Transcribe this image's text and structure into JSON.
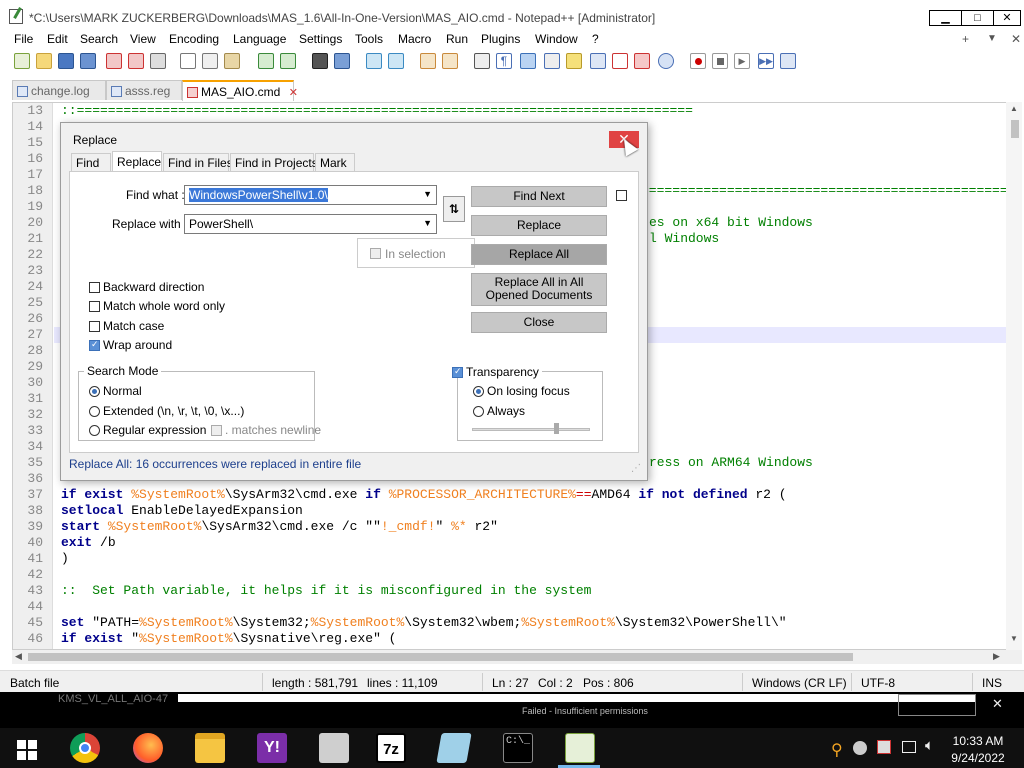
{
  "window": {
    "title": "*C:\\Users\\MARK ZUCKERBERG\\Downloads\\MAS_1.6\\All-In-One-Version\\MAS_AIO.cmd - Notepad++ [Administrator]",
    "min": "▁",
    "max": "□",
    "close": "✕"
  },
  "menu": [
    "File",
    "Edit",
    "Search",
    "View",
    "Encoding",
    "Language",
    "Settings",
    "Tools",
    "Macro",
    "Run",
    "Plugins",
    "Window",
    "?"
  ],
  "menu_right": {
    "plus": "+",
    "down": "▼",
    "close": "✕"
  },
  "tabs": [
    {
      "label": "change.log",
      "active": false
    },
    {
      "label": "asss.reg",
      "active": false
    },
    {
      "label": "MAS_AIO.cmd",
      "active": true
    }
  ],
  "editor": {
    "line_numbers": [
      "13",
      "14",
      "15",
      "16",
      "17",
      "18",
      "19",
      "20",
      "21",
      "22",
      "23",
      "24",
      "25",
      "26",
      "27",
      "28",
      "29",
      "30",
      "31",
      "32",
      "33",
      "34",
      "35",
      "36",
      "37",
      "38",
      "39",
      "40",
      "41",
      "42",
      "43",
      "44",
      "45",
      "46"
    ],
    "visible_fragments": {
      "l13": "::===============================================================================",
      "l18": "====================================================================",
      "l20": "es on x64 bit Windows",
      "l21": "l Windows",
      "l35": "ress on ARM64 Windows"
    },
    "line37": {
      "kw1": "if exist ",
      "var1": "%SystemRoot%",
      "t1": "\\SysArm32\\cmd.exe ",
      "kw2": "if ",
      "var2": "%PROCESSOR_ARCHITECTURE%",
      "op": "==",
      "t2": "AMD64 ",
      "kw3": "if not defined",
      "t3": " r2 ("
    },
    "line38": {
      "kw": "setlocal",
      "t": " EnableDelayedExpansion"
    },
    "line39": {
      "kw": "start ",
      "var1": "%SystemRoot%",
      "t1": "\\SysArm32\\cmd.exe /c \"\"",
      "var2": "!_cmdf!",
      "t2": "\" ",
      "var3": "%*",
      "t3": " r2\""
    },
    "line40": {
      "kw": "exit",
      "t": " /b"
    },
    "line41": ")",
    "line43": "::  Set Path variable, it helps if it is misconfigured in the system",
    "line45": {
      "kw": "set ",
      "t1": "\"PATH=",
      "var1": "%SystemRoot%",
      "t2": "\\System32;",
      "var2": "%SystemRoot%",
      "t3": "\\System32\\wbem;",
      "var3": "%SystemRoot%",
      "t4": "\\System32\\PowerShell\\\""
    },
    "line46": {
      "kw": "if exist ",
      "t1": "\"",
      "var1": "%SystemRoot%",
      "t2": "\\Sysnative\\reg.exe\" ("
    }
  },
  "status": {
    "filetype": "Batch file",
    "length": "length : 581,791",
    "lines": "lines : 11,109",
    "ln": "Ln : 27",
    "col": "Col : 2",
    "pos": "Pos : 806",
    "eol": "Windows (CR LF)",
    "encoding": "UTF-8",
    "ins": "INS"
  },
  "behind": {
    "window_text": "KMS_VL_ALL_AIO-47",
    "failed": "Failed - Insufficient permissions"
  },
  "dialog": {
    "title": "Replace",
    "close": "✕",
    "tabs": [
      "Find",
      "Replace",
      "Find in Files",
      "Find in Projects",
      "Mark"
    ],
    "active_tab": "Replace",
    "find_label": "Find what :",
    "find_value": "WindowsPowerShell\\v1.0\\",
    "replace_label": "Replace with :",
    "replace_value": "PowerShell\\",
    "swap": "⇅",
    "in_selection": "In selection",
    "buttons": {
      "find_next": "Find Next",
      "replace": "Replace",
      "replace_all": "Replace All",
      "replace_all_opened": "Replace All in All Opened Documents",
      "close": "Close"
    },
    "options": [
      {
        "label": "Backward direction",
        "checked": false
      },
      {
        "label": "Match whole word only",
        "checked": false
      },
      {
        "label": "Match case",
        "checked": false
      },
      {
        "label": "Wrap around",
        "checked": true
      }
    ],
    "search_mode": {
      "title": "Search Mode",
      "normal": "Normal",
      "extended": "Extended (\\n, \\r, \\t, \\0, \\x...)",
      "regex": "Regular expression",
      "matches_newline": ". matches newline",
      "selected": "Normal"
    },
    "transparency": {
      "title": "Transparency",
      "enabled": true,
      "on_losing_focus": "On losing focus",
      "always": "Always",
      "selected": "On losing focus"
    },
    "status_message": "Replace All: 16 occurrences were replaced in entire file"
  },
  "tray": {
    "time": "10:33 AM",
    "date": "9/24/2022"
  },
  "colors": {
    "accent": "#3b70b8",
    "close_red": "#e04343",
    "comment": "#008000",
    "keyword": "#00008b",
    "variable": "#f08020"
  }
}
